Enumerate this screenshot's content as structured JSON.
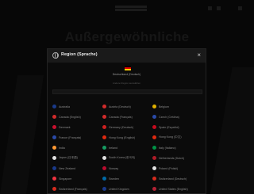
{
  "background": {
    "headline": "Außergewöhnliche"
  },
  "modal": {
    "title": "Region (Sprache)",
    "close_glyph": "×",
    "current_region": "Deutschland (Deutsch)",
    "current_subtext": "Andere Region auswählen",
    "search_placeholder": ""
  },
  "regions": [
    {
      "label": "Australia",
      "color": "#1a3a8a"
    },
    {
      "label": "Austria (Deutsch)",
      "color": "#d12b2b"
    },
    {
      "label": "Belgium",
      "color": "#e0b000"
    },
    {
      "label": "Canada (English)",
      "color": "#d12b2b"
    },
    {
      "label": "Canada (Français)",
      "color": "#d12b2b"
    },
    {
      "label": "Czech (Čeština)",
      "color": "#2a4aa8"
    },
    {
      "label": "Denmark",
      "color": "#c8102e"
    },
    {
      "label": "Germany (Deutsch)",
      "color": "#cc2020"
    },
    {
      "label": "Spain (Español)",
      "color": "#c60b1e"
    },
    {
      "label": "France (Français)",
      "color": "#2a4aa8"
    },
    {
      "label": "Hong Kong (English)",
      "color": "#de2910"
    },
    {
      "label": "Hong Kong (中文)",
      "color": "#de2910"
    },
    {
      "label": "India",
      "color": "#ff9933"
    },
    {
      "label": "Ireland",
      "color": "#169b62"
    },
    {
      "label": "Italy (Italiano)",
      "color": "#009246"
    },
    {
      "label": "Japan (日本語)",
      "color": "#e0e0e0"
    },
    {
      "label": "South Korea (한국어)",
      "color": "#e0e0e0"
    },
    {
      "label": "Netherlands (Dutch)",
      "color": "#ae1c28"
    },
    {
      "label": "New Zealand",
      "color": "#1a3a8a"
    },
    {
      "label": "Norway",
      "color": "#ba0c2f"
    },
    {
      "label": "Poland (Polski)",
      "color": "#e0e0e0"
    },
    {
      "label": "Singapore",
      "color": "#ef3340"
    },
    {
      "label": "Sweden",
      "color": "#006aa7"
    },
    {
      "label": "Switzerland (Deutsch)",
      "color": "#d52b1e"
    },
    {
      "label": "Switzerland (Français)",
      "color": "#d52b1e"
    },
    {
      "label": "United Kingdom",
      "color": "#1a3a8a"
    },
    {
      "label": "United States (English)",
      "color": "#b22234"
    }
  ]
}
